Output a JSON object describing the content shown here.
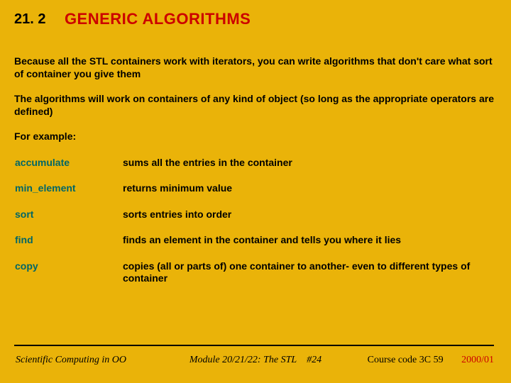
{
  "header": {
    "section_number": "21. 2",
    "title": "GENERIC ALGORITHMS"
  },
  "body": {
    "para1": "Because all the STL containers work with iterators, you can write algorithms that don't care what sort of container you give them",
    "para2": "The algorithms will work on containers of any kind of object (so long as the appropriate operators are defined)",
    "example_label": "For example:",
    "functions": [
      {
        "name": "accumulate",
        "desc": "sums all the entries in the container"
      },
      {
        "name": "min_element",
        "desc": "returns minimum value"
      },
      {
        "name": "sort",
        "desc": "sorts entries into order"
      },
      {
        "name": "find",
        "desc": "finds an element in the container and tells you where it lies"
      },
      {
        "name": "copy",
        "desc": "copies (all or parts of) one container to another- even to different types of container"
      }
    ]
  },
  "footer": {
    "left": "Scientific Computing in OO",
    "center_module": "Module 20/21/22: The STL",
    "center_page": "#24",
    "right_course": "Course code 3C 59",
    "right_year": "2000/01"
  }
}
